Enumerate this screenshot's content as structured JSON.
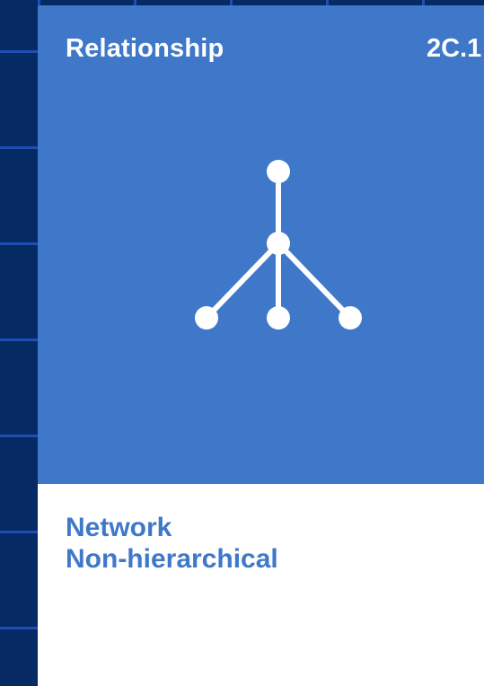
{
  "card": {
    "category": "Relationship",
    "code": "2C.1",
    "title_lines": [
      "Network",
      "Non-hierarchical"
    ],
    "icon": "network-tree-icon"
  },
  "colors": {
    "background_grid": "#062a63",
    "grid_lines": "#1d4fb5",
    "card_accent": "#3f78c9",
    "card_body": "#ffffff",
    "icon_and_header_text": "#ffffff"
  }
}
